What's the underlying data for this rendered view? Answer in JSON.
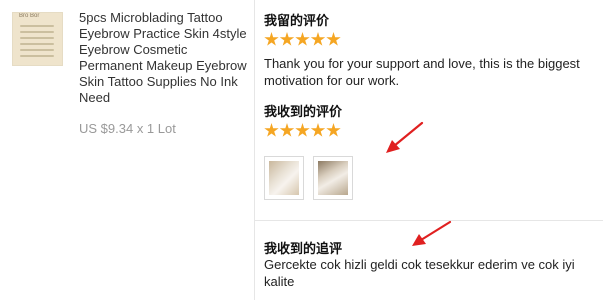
{
  "product": {
    "thumb_tag": "Bro Bor",
    "title": "5pcs Microblading Tattoo Eyebrow Practice Skin 4style Eyebrow Cosmetic Permanent Makeup Eyebrow Skin Tattoo Supplies No Ink Need",
    "price": "US $9.34 x 1 Lot"
  },
  "my_feedback": {
    "heading": "我留的评价",
    "rating": 5,
    "text": "Thank you for your support and love, this is the biggest motivation for our work."
  },
  "received_feedback": {
    "heading": "我收到的评价",
    "rating": 5,
    "photos": [
      "review-photo-1",
      "review-photo-2"
    ]
  },
  "followup": {
    "heading": "我收到的追评",
    "text": "Gercekte cok hizli geldi cok tesekkur ederim ve cok iyi kalite"
  },
  "colors": {
    "star": "#f5a623",
    "arrow": "#e02020",
    "price": "#999999",
    "divider": "#e6e6e6"
  }
}
